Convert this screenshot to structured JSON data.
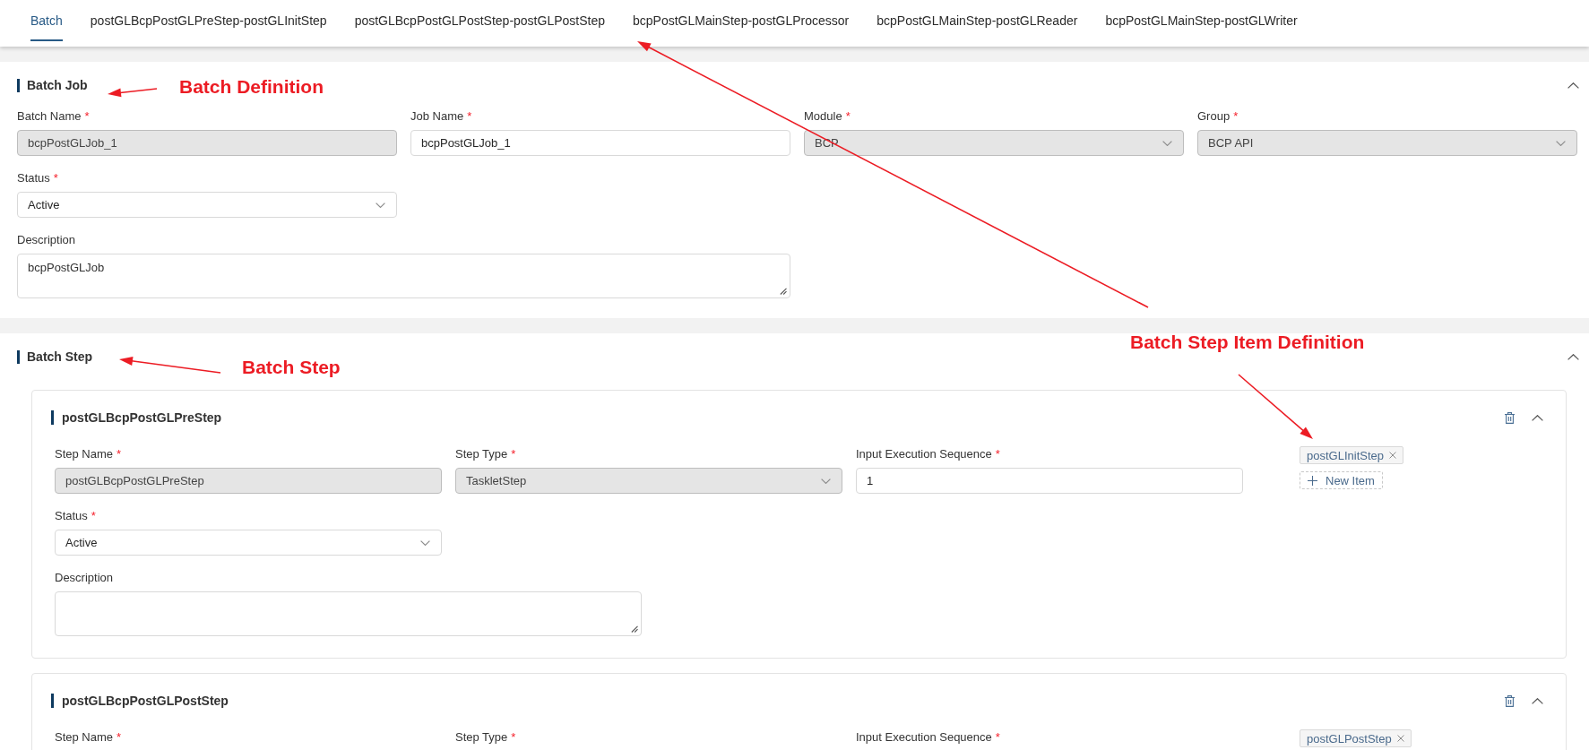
{
  "tabs": [
    {
      "label": "Batch",
      "selected": true
    },
    {
      "label": "postGLBcpPostGLPreStep-postGLInitStep",
      "selected": false
    },
    {
      "label": "postGLBcpPostGLPostStep-postGLPostStep",
      "selected": false
    },
    {
      "label": "bcpPostGLMainStep-postGLProcessor",
      "selected": false
    },
    {
      "label": "bcpPostGLMainStep-postGLReader",
      "selected": false
    },
    {
      "label": "bcpPostGLMainStep-postGLWriter",
      "selected": false
    }
  ],
  "batch_job": {
    "title": "Batch Job",
    "expanded": true,
    "fields": [
      {
        "kind": "text",
        "label": "Batch Name",
        "required_mark": "*",
        "value": "bcpPostGLJob_1",
        "disabled": true
      },
      {
        "kind": "text",
        "label": "Job Name",
        "required_mark": "*",
        "value": "bcpPostGLJob_1",
        "disabled": false
      },
      {
        "kind": "select",
        "label": "Module",
        "required_mark": "*",
        "value": "BCP",
        "disabled": true
      },
      {
        "kind": "select",
        "label": "Group",
        "required_mark": "*",
        "value": "BCP API",
        "disabled": true
      },
      {
        "kind": "select",
        "label": "Status",
        "required_mark": "*",
        "value": "Active",
        "disabled": false
      },
      {
        "kind": "textarea",
        "label": "Description",
        "value": "bcpPostGLJob",
        "disabled": false
      }
    ]
  },
  "batch_step": {
    "title": "Batch Step",
    "expanded": true,
    "steps": [
      {
        "title": "postGLBcpPostGLPreStep",
        "expanded": true,
        "fields": [
          {
            "kind": "text",
            "label": "Step Name",
            "required_mark": "*",
            "value": "postGLBcpPostGLPreStep",
            "disabled": true
          },
          {
            "kind": "select",
            "label": "Step Type",
            "required_mark": "*",
            "value": "TaskletStep",
            "disabled": true
          },
          {
            "kind": "text",
            "label": "Input Execution Sequence",
            "required_mark": "*",
            "value": "1",
            "disabled": false
          },
          {
            "kind": "select",
            "label": "Status",
            "required_mark": "*",
            "value": "Active",
            "disabled": false
          },
          {
            "kind": "textarea",
            "label": "Description",
            "disabled": false
          }
        ],
        "items": [
          {
            "label": "postGLInitStep"
          }
        ],
        "new_item_label": "New Item"
      },
      {
        "title": "postGLBcpPostGLPostStep",
        "expanded": true,
        "fields": [
          {
            "label": "Step Name",
            "required_mark": "*"
          },
          {
            "label": "Step Type",
            "required_mark": "*"
          },
          {
            "label": "Input Execution Sequence",
            "required_mark": "*"
          }
        ],
        "items": [
          {
            "label": "postGLPostStep"
          }
        ]
      }
    ]
  },
  "annotations": [
    {
      "text": "Batch Definition"
    },
    {
      "text": "Batch Step"
    },
    {
      "text": "Batch Step Item Definition"
    }
  ]
}
